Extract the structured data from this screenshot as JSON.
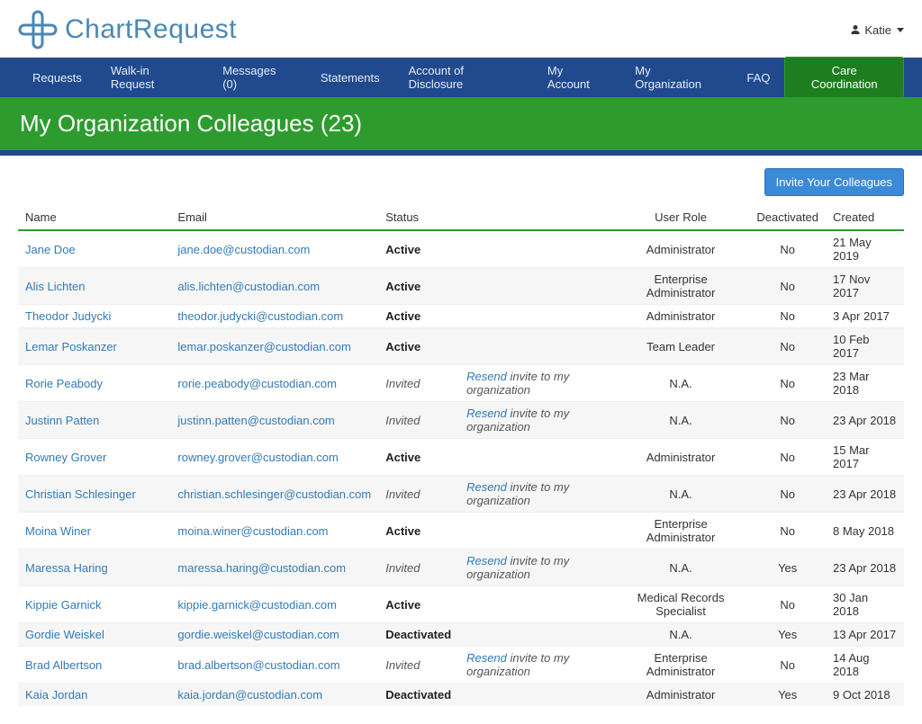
{
  "header": {
    "brand": "ChartRequest",
    "user_name": "Katie"
  },
  "nav": {
    "items": [
      "Requests",
      "Walk-in Request",
      "Messages (0)",
      "Statements",
      "Account of Disclosure",
      "My Account",
      "My Organization",
      "FAQ"
    ],
    "care_btn": "Care Coordination"
  },
  "page": {
    "title": "My Organization Colleagues (23)",
    "invite_btn": "Invite Your Colleagues"
  },
  "table": {
    "headers": {
      "name": "Name",
      "email": "Email",
      "status": "Status",
      "role": "User Role",
      "deactivated": "Deactivated",
      "created": "Created"
    },
    "resend_label": "Resend",
    "invite_suffix": " invite to my organization",
    "rows": [
      {
        "name": "Jane Doe",
        "email": "jane.doe@custodian.com",
        "status": "Active",
        "role": "Administrator",
        "deactivated": "No",
        "created": "21 May 2019"
      },
      {
        "name": "Alis Lichten",
        "email": "alis.lichten@custodian.com",
        "status": "Active",
        "role": "Enterprise Administrator",
        "deactivated": "No",
        "created": "17 Nov 2017"
      },
      {
        "name": "Theodor Judycki",
        "email": "theodor.judycki@custodian.com",
        "status": "Active",
        "role": "Administrator",
        "deactivated": "No",
        "created": "3 Apr 2017"
      },
      {
        "name": "Lemar Poskanzer",
        "email": "lemar.poskanzer@custodian.com",
        "status": "Active",
        "role": "Team Leader",
        "deactivated": "No",
        "created": "10 Feb 2017"
      },
      {
        "name": "Rorie Peabody",
        "email": "rorie.peabody@custodian.com",
        "status": "Invited",
        "role": "N.A.",
        "deactivated": "No",
        "created": "23 Mar 2018"
      },
      {
        "name": "Justinn Patten",
        "email": "justinn.patten@custodian.com",
        "status": "Invited",
        "role": "N.A.",
        "deactivated": "No",
        "created": "23 Apr 2018"
      },
      {
        "name": "Rowney Grover",
        "email": "rowney.grover@custodian.com",
        "status": "Active",
        "role": "Administrator",
        "deactivated": "No",
        "created": "15 Mar 2017"
      },
      {
        "name": "Christian Schlesinger",
        "email": "christian.schlesinger@custodian.com",
        "status": "Invited",
        "role": "N.A.",
        "deactivated": "No",
        "created": "23 Apr 2018"
      },
      {
        "name": "Moina Winer",
        "email": "moina.winer@custodian.com",
        "status": "Active",
        "role": "Enterprise Administrator",
        "deactivated": "No",
        "created": "8 May 2018"
      },
      {
        "name": "Maressa Haring",
        "email": "maressa.haring@custodian.com",
        "status": "Invited",
        "role": "N.A.",
        "deactivated": "Yes",
        "created": "23 Apr 2018"
      },
      {
        "name": "Kippie Garnick",
        "email": "kippie.garnick@custodian.com",
        "status": "Active",
        "role": "Medical Records Specialist",
        "deactivated": "No",
        "created": "30 Jan 2018"
      },
      {
        "name": "Gordie Weiskel",
        "email": "gordie.weiskel@custodian.com",
        "status": "Deactivated",
        "role": "N.A.",
        "deactivated": "Yes",
        "created": "13 Apr 2017"
      },
      {
        "name": "Brad Albertson",
        "email": "brad.albertson@custodian.com",
        "status": "Invited",
        "role": "Enterprise Administrator",
        "deactivated": "No",
        "created": "14 Aug 2018"
      },
      {
        "name": "Kaia Jordan",
        "email": "kaia.jordan@custodian.com",
        "status": "Deactivated",
        "role": "Administrator",
        "deactivated": "Yes",
        "created": "9 Oct 2018"
      }
    ]
  }
}
